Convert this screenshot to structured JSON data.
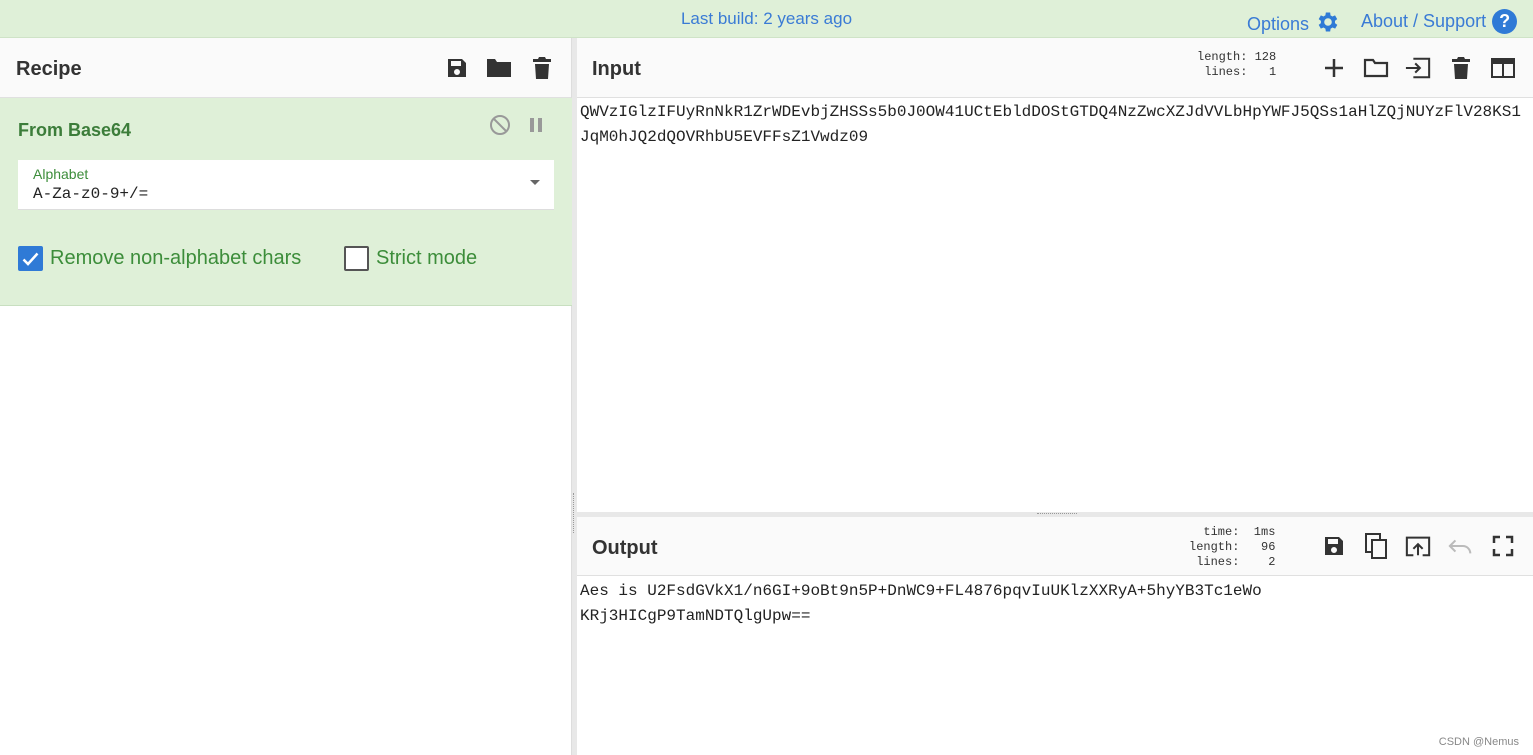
{
  "topbar": {
    "build_status": "Last build: 2 years ago",
    "options_label": "Options",
    "about_label": "About / Support",
    "help_glyph": "?"
  },
  "recipe": {
    "title": "Recipe",
    "operation": {
      "name": "From Base64",
      "alphabet_label": "Alphabet",
      "alphabet_value": "A-Za-z0-9+/=",
      "remove_non_alphabet_label": "Remove non-alphabet chars",
      "remove_non_alphabet_checked": true,
      "strict_mode_label": "Strict mode",
      "strict_mode_checked": false
    }
  },
  "input": {
    "title": "Input",
    "stats": "length: 128\n lines:   1",
    "text_line1": "QWVzIGlzIFUyRnNkR1ZrWDEvbjZHSSs5b0J0OW41UCtEbldDOStGTDQ4NzZwcXZJdVVLbHpYWFJ5QSs1aHlZQjNUYzFlV28KS1",
    "text_line2": "JqM0hJQ2dQOVRhbU5EVFFsZ1Vwdz09"
  },
  "output": {
    "title": "Output",
    "stats": "  time:  1ms\nlength:   96\n lines:    2",
    "text_line1": "Aes is U2FsdGVkX1/n6GI+9oBt9n5P+DnWC9+FL4876pqvIuUKlzXXRyA+5hyYB3Tc1eWo",
    "text_line2": "KRj3HICgP9TamNDTQlgUpw=="
  },
  "watermark": "CSDN @Nemus",
  "colors": {
    "accent_blue": "#2f7ad6",
    "topbar_bg": "#dff0d8",
    "operation_green": "#3c7d3a"
  }
}
